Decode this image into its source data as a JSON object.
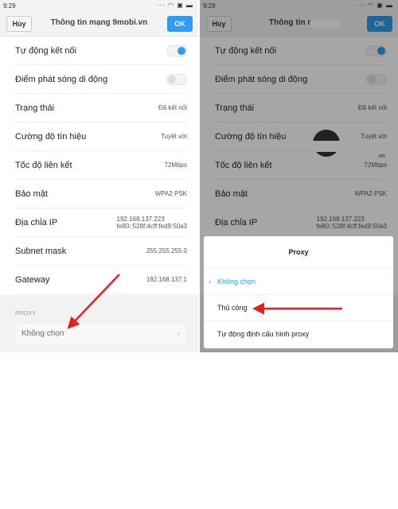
{
  "status_time": "9:29",
  "toolbar": {
    "cancel": "Hủy",
    "ok": "OK",
    "title_left": "Thông tin mạng 9mobi.vn",
    "title_right": "Thông tin mạng"
  },
  "rows": [
    {
      "label": "Tự động kết nối",
      "type": "toggle",
      "on": true
    },
    {
      "label": "Điểm phát sóng di động",
      "type": "toggle",
      "on": false
    },
    {
      "label": "Trạng thái",
      "value": "Đã kết nối"
    },
    {
      "label": "Cường độ tín hiệu",
      "value": "Tuyệt vời"
    },
    {
      "label": "Tốc độ liên kết",
      "value": "72Mbps"
    },
    {
      "label": "Bảo mật",
      "value": "WPA2 PSK"
    },
    {
      "label": "Địa chỉa IP",
      "value": "192.168.137.223",
      "value2": "fe80::528f:4cff:fed9:50a3"
    },
    {
      "label": "Subnet mask",
      "value": "255.255.255.0"
    },
    {
      "label": "Gateway",
      "value": "192.168.137.1"
    }
  ],
  "proxy": {
    "section_label": "PROXY",
    "value": "Không chọn"
  },
  "dialog": {
    "title": "Proxy",
    "options": [
      {
        "label": "Không chọn",
        "selected": true
      },
      {
        "label": "Thủ công",
        "selected": false
      },
      {
        "label": "Tự động định cấu hình proxy",
        "selected": false
      }
    ]
  },
  "watermark_suffix": ".vn",
  "colors": {
    "accent": "#2e9cf0",
    "arrow": "#e8201c"
  }
}
